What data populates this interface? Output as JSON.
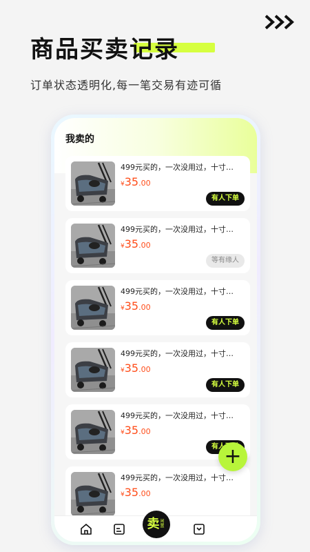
{
  "header": {
    "title": "商品买卖记录",
    "subtitle": "订单状态透明化,每一笔交易有迹可循",
    "arrows_icon": "triple-chevron-right-icon"
  },
  "screen": {
    "section_title": "我卖的",
    "items": [
      {
        "title": "499元买的，一次没用过，十寸…",
        "currency": "¥",
        "price_int": "35",
        "price_dec": ".00",
        "status": "有人下单",
        "status_type": "active"
      },
      {
        "title": "499元买的，一次没用过，十寸…",
        "currency": "¥",
        "price_int": "35",
        "price_dec": ".00",
        "status": "等有缘人",
        "status_type": "waiting"
      },
      {
        "title": "499元买的，一次没用过，十寸…",
        "currency": "¥",
        "price_int": "35",
        "price_dec": ".00",
        "status": "有人下单",
        "status_type": "active"
      },
      {
        "title": "499元买的，一次没用过，十寸…",
        "currency": "¥",
        "price_int": "35",
        "price_dec": ".00",
        "status": "有人下单",
        "status_type": "active"
      },
      {
        "title": "499元买的，一次没用过，十寸…",
        "currency": "¥",
        "price_int": "35",
        "price_dec": ".00",
        "status": "有人下单",
        "status_type": "active"
      },
      {
        "title": "499元买的，一次没用过，十寸…",
        "currency": "¥",
        "price_int": "35",
        "price_dec": ".00",
        "status": "",
        "status_type": "hidden"
      }
    ],
    "fab_label": "+",
    "tabbar": {
      "center_big": "卖",
      "center_small": "闲置"
    }
  },
  "colors": {
    "accent": "#d6ff3f",
    "fab": "#b8f53a",
    "price": "#ff4d1a",
    "dark": "#111111"
  }
}
